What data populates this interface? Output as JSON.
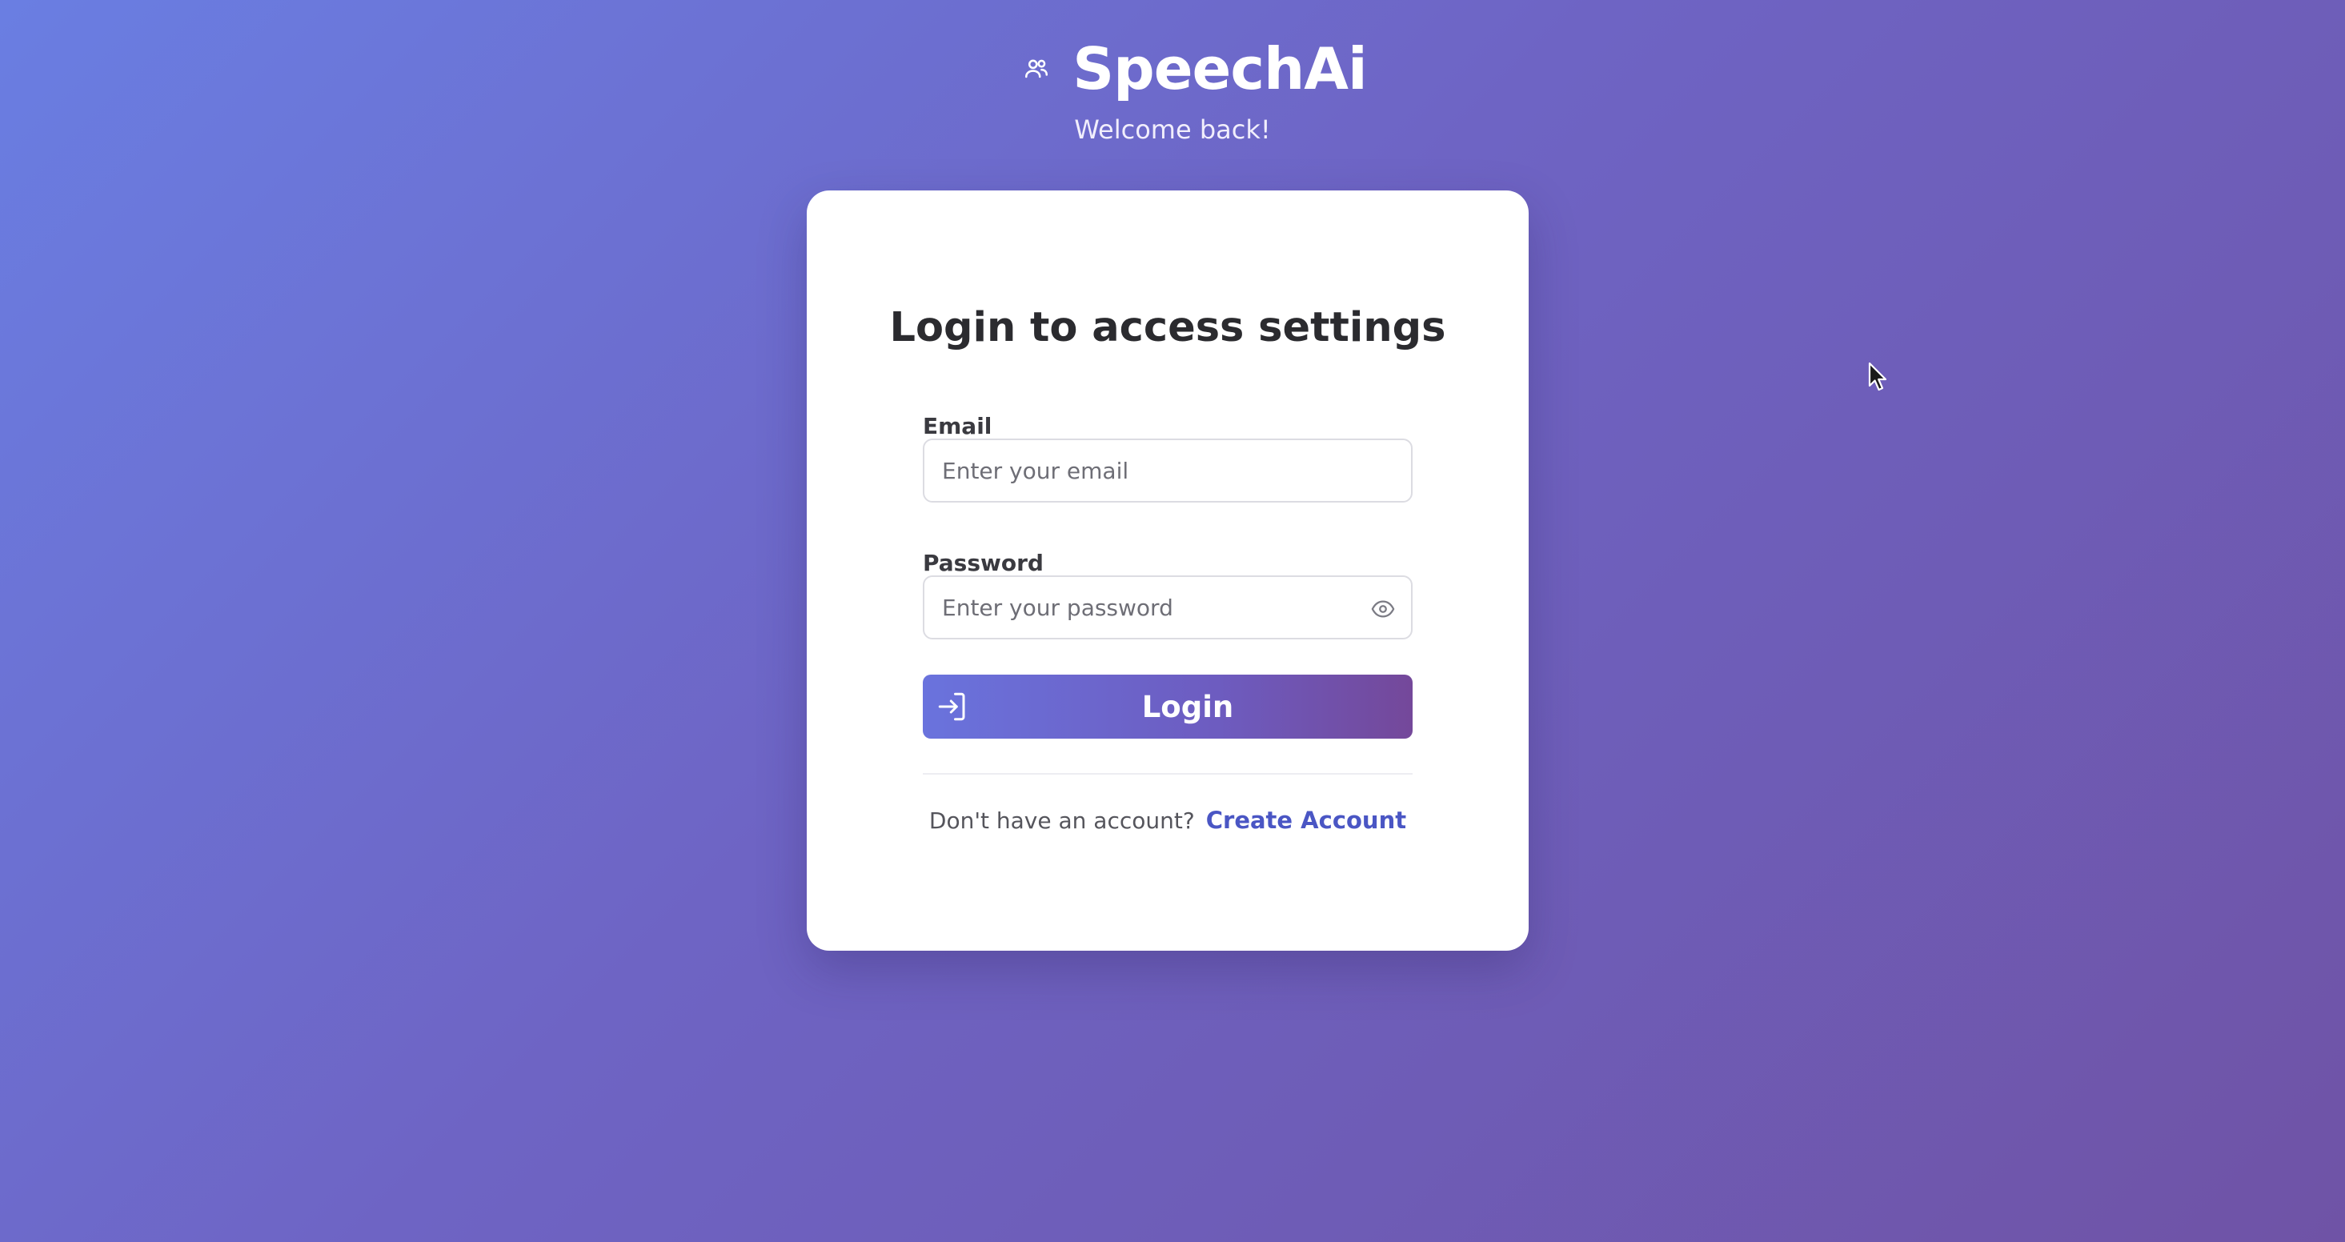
{
  "header": {
    "app_name": "SpeechAi",
    "subtitle": "Welcome back!",
    "logo_icon": "users-icon"
  },
  "card": {
    "title": "Login to access settings",
    "email": {
      "label": "Email",
      "placeholder": "Enter your email",
      "value": ""
    },
    "password": {
      "label": "Password",
      "placeholder": "Enter your password",
      "value": "",
      "toggle_icon": "eye-icon"
    },
    "login_button": {
      "label": "Login",
      "icon": "login-arrow-icon"
    },
    "signup_prompt": "Don't have an account?",
    "signup_link": "Create Account"
  },
  "colors": {
    "background_start": "#6a7ee2",
    "background_end": "#6f53a6",
    "button_start": "#6a73dd",
    "button_end": "#74489a",
    "link": "#4a56c4"
  }
}
